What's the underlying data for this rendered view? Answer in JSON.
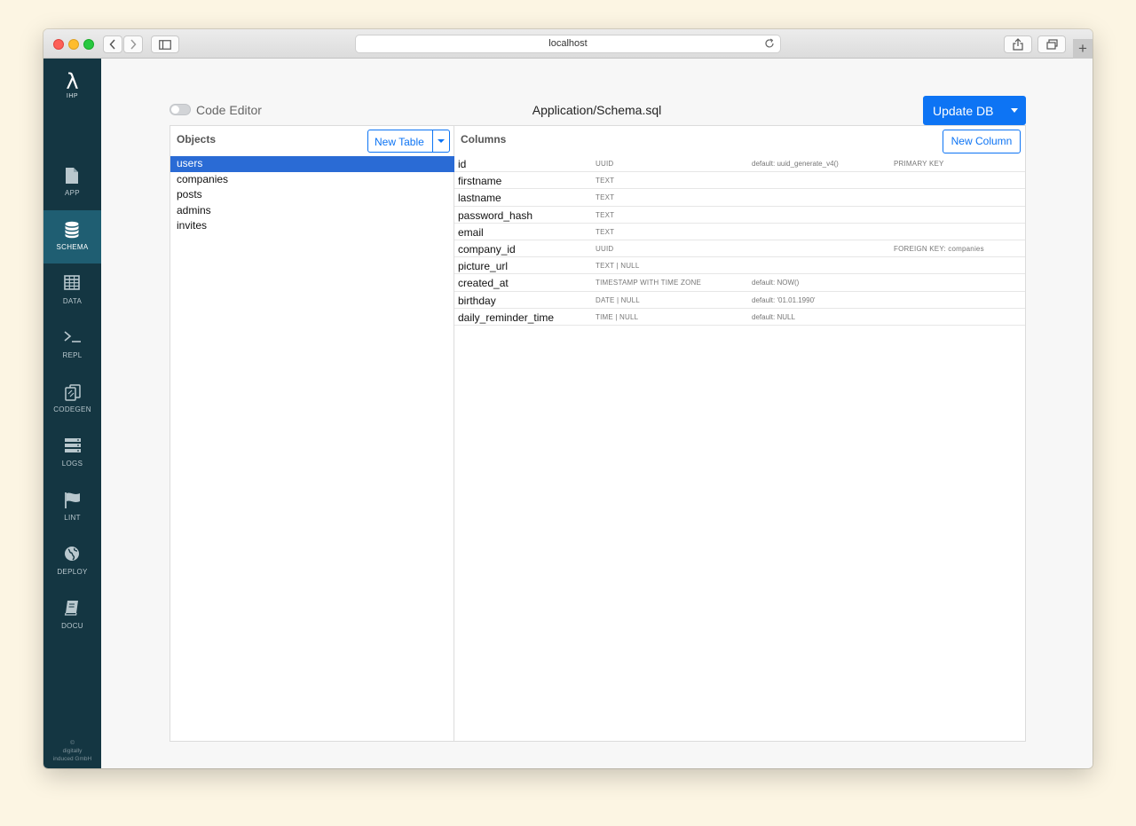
{
  "browser": {
    "url": "localhost"
  },
  "sidebar": {
    "logo": {
      "symbol": "λ",
      "text": "IHP"
    },
    "items": [
      {
        "label": "APP",
        "icon": "file-icon"
      },
      {
        "label": "SCHEMA",
        "icon": "database-icon",
        "active": true
      },
      {
        "label": "DATA",
        "icon": "table-icon"
      },
      {
        "label": "REPL",
        "icon": "terminal-icon"
      },
      {
        "label": "CODEGEN",
        "icon": "copy-icon"
      },
      {
        "label": "LOGS",
        "icon": "server-icon"
      },
      {
        "label": "LINT",
        "icon": "flag-icon"
      },
      {
        "label": "DEPLOY",
        "icon": "globe-icon"
      },
      {
        "label": "DOCU",
        "icon": "book-icon"
      }
    ],
    "copyright": [
      "©",
      "digitally",
      "induced GmbH"
    ]
  },
  "toolbar": {
    "code_editor_label": "Code Editor",
    "file_title": "Application/Schema.sql",
    "update_button": "Update DB"
  },
  "objects": {
    "title": "Objects",
    "new_table_button": "New Table",
    "tables": [
      "users",
      "companies",
      "posts",
      "admins",
      "invites"
    ],
    "selected": "users"
  },
  "columns": {
    "title": "Columns",
    "new_column_button": "New Column",
    "rows": [
      {
        "name": "id",
        "type": "UUID",
        "default": "default: uuid_generate_v4()",
        "constraint": "PRIMARY KEY"
      },
      {
        "name": "firstname",
        "type": "TEXT",
        "default": "",
        "constraint": ""
      },
      {
        "name": "lastname",
        "type": "TEXT",
        "default": "",
        "constraint": ""
      },
      {
        "name": "password_hash",
        "type": "TEXT",
        "default": "",
        "constraint": ""
      },
      {
        "name": "email",
        "type": "TEXT",
        "default": "",
        "constraint": ""
      },
      {
        "name": "company_id",
        "type": "UUID",
        "default": "",
        "constraint": "FOREIGN KEY: companies"
      },
      {
        "name": "picture_url",
        "type": "TEXT | NULL",
        "default": "",
        "constraint": ""
      },
      {
        "name": "created_at",
        "type": "TIMESTAMP WITH TIME ZONE",
        "default": "default: NOW()",
        "constraint": ""
      },
      {
        "name": "birthday",
        "type": "DATE | NULL",
        "default": "default: '01.01.1990'",
        "constraint": ""
      },
      {
        "name": "daily_reminder_time",
        "type": "TIME | NULL",
        "default": "default: NULL",
        "constraint": ""
      }
    ]
  },
  "colors": {
    "accent": "#0d74f4",
    "sidebar": "#143642",
    "sidebar_active": "#1f5e72",
    "selection": "#2a6bd5"
  }
}
